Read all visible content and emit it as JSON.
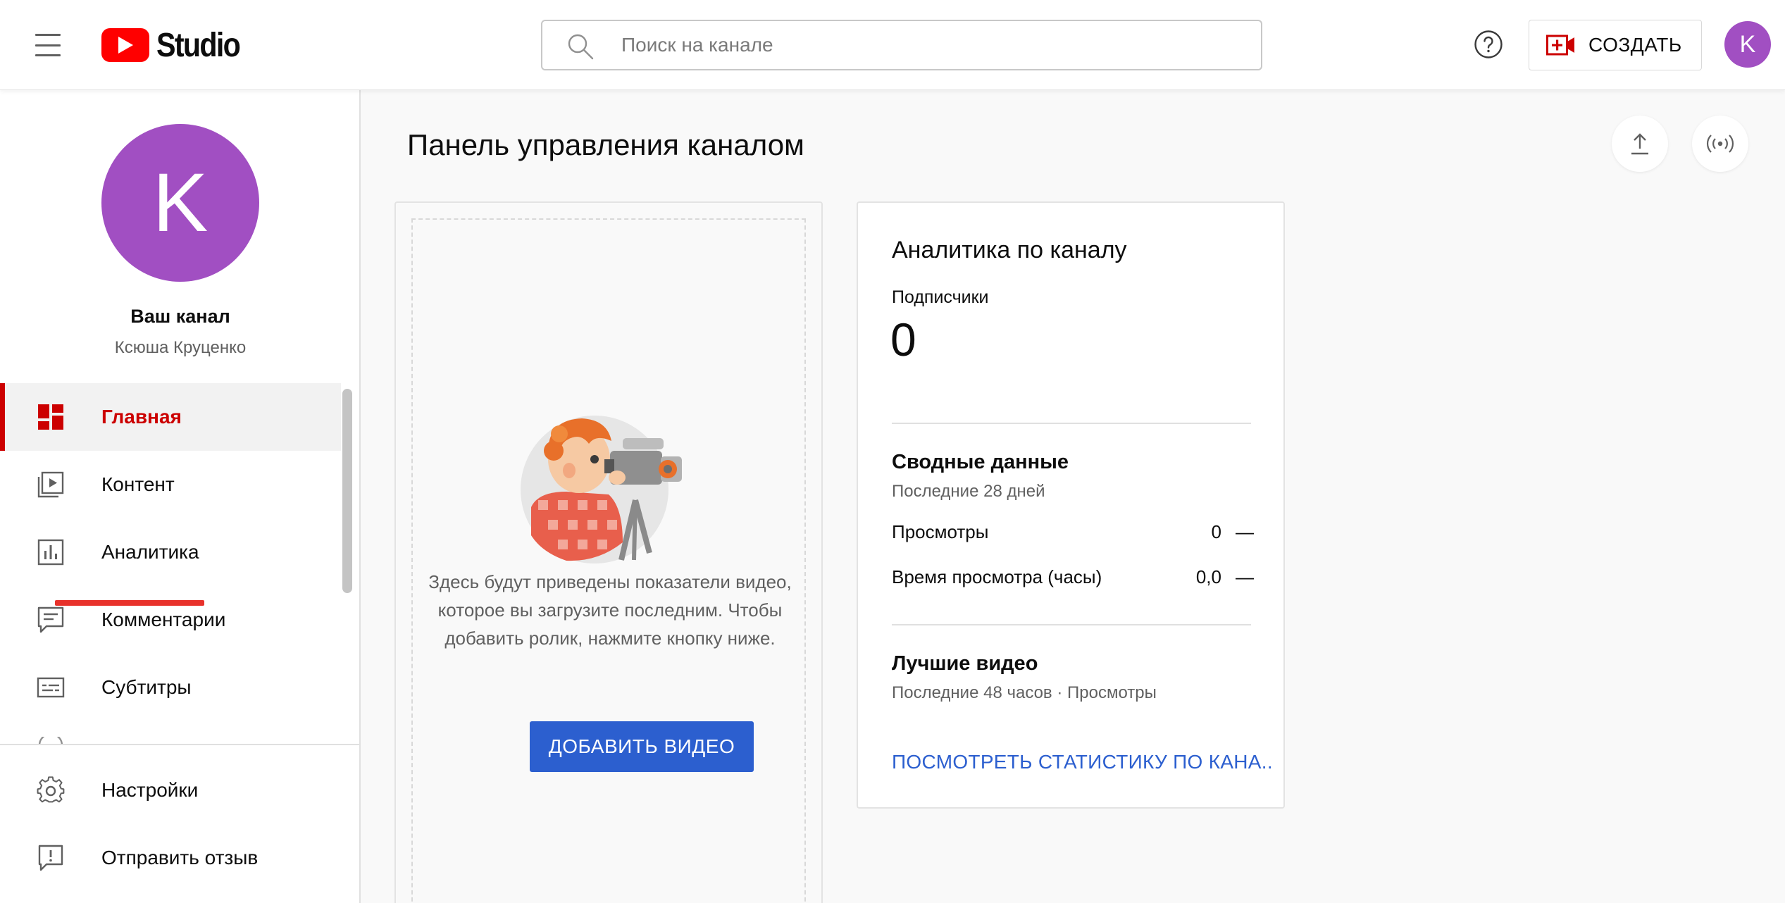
{
  "header": {
    "logo_text": "Studio",
    "search_placeholder": "Поиск на канале",
    "create_label": "СОЗДАТЬ",
    "avatar_letter": "K"
  },
  "sidebar": {
    "avatar_letter": "K",
    "channel_title": "Ваш канал",
    "channel_name": "Ксюша Круценко",
    "items": [
      {
        "label": "Главная",
        "icon": "dashboard-icon",
        "active": true
      },
      {
        "label": "Контент",
        "icon": "content-icon"
      },
      {
        "label": "Аналитика",
        "icon": "analytics-icon"
      },
      {
        "label": "Комментарии",
        "icon": "comments-icon"
      },
      {
        "label": "Субтитры",
        "icon": "subtitles-icon"
      }
    ],
    "bottom_items": [
      {
        "label": "Настройки",
        "icon": "gear-icon"
      },
      {
        "label": "Отправить отзыв",
        "icon": "feedback-icon"
      }
    ]
  },
  "main": {
    "page_title": "Панель управления каналом",
    "empty_state": {
      "text": "Здесь будут приведены показатели видео, которое вы загрузите последним. Чтобы добавить ролик, нажмите кнопку ниже.",
      "button": "ДОБАВИТЬ ВИДЕО"
    },
    "analytics": {
      "title": "Аналитика по каналу",
      "subscribers_label": "Подписчики",
      "subscribers_value": "0",
      "summary_title": "Сводные данные",
      "summary_period": "Последние 28 дней",
      "rows": [
        {
          "label": "Просмотры",
          "value": "0",
          "trend": "—"
        },
        {
          "label": "Время просмотра (часы)",
          "value": "0,0",
          "trend": "—"
        }
      ],
      "top_title": "Лучшие видео",
      "top_period": "Последние 48 часов · Просмотры",
      "link": "ПОСМОТРЕТЬ СТАТИСТИКУ ПО КАНА..."
    }
  },
  "colors": {
    "accent_red": "#cc0000",
    "avatar_purple": "#a14fc2",
    "link_blue": "#2c5fcf"
  }
}
